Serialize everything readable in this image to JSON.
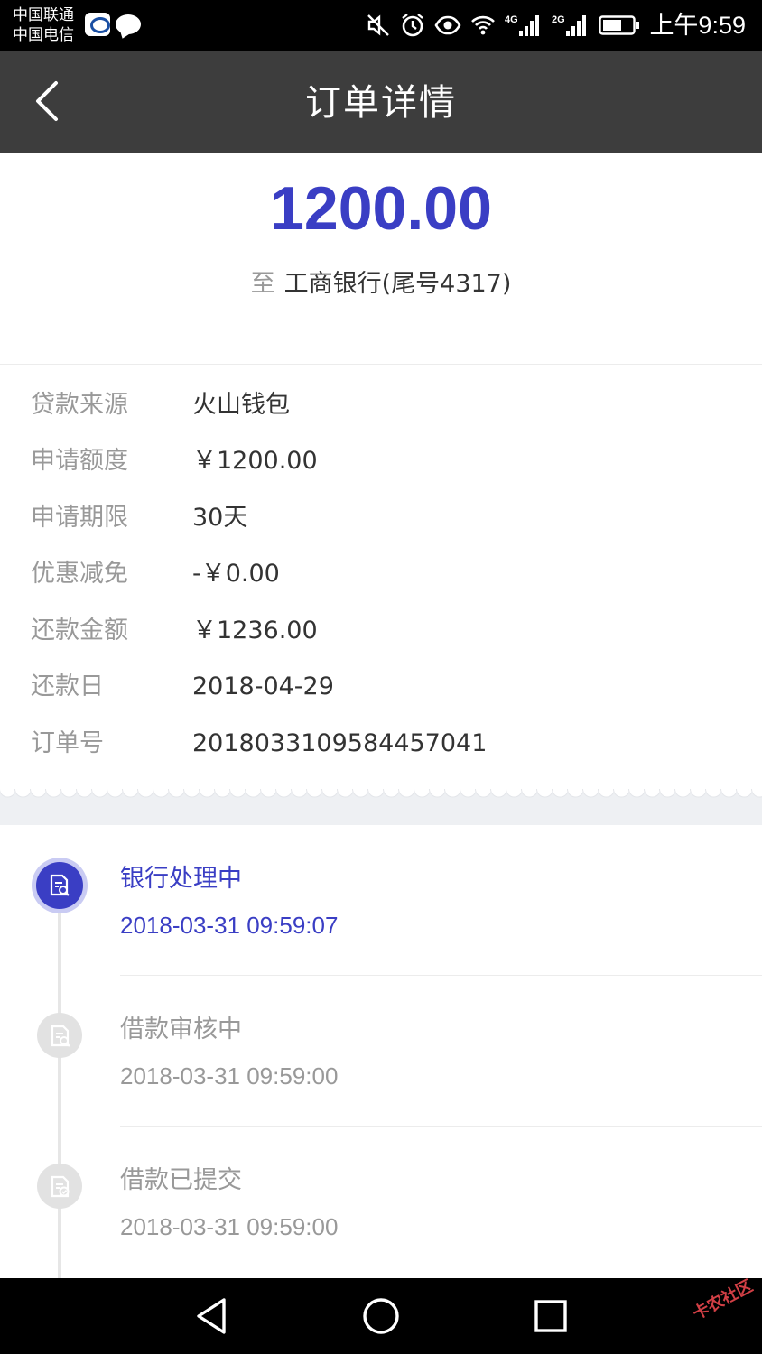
{
  "status_bar": {
    "carrier_1": "中国联通",
    "carrier_2": "中国电信",
    "network_1": "4G",
    "network_2": "2G",
    "time": "上午9:59"
  },
  "header": {
    "title": "订单详情",
    "back_icon": "chevron-left-icon"
  },
  "summary": {
    "amount": "1200.00",
    "dest_prefix": "至",
    "dest_account": "工商银行(尾号4317)",
    "accent_color": "#3a3ec4"
  },
  "details": [
    {
      "label": "贷款来源",
      "value": "火山钱包"
    },
    {
      "label": "申请额度",
      "value": "￥1200.00"
    },
    {
      "label": "申请期限",
      "value": "30天"
    },
    {
      "label": "优惠减免",
      "value": "-￥0.00"
    },
    {
      "label": "还款金额",
      "value": "￥1236.00"
    },
    {
      "label": "还款日",
      "value": "2018-04-29"
    },
    {
      "label": "订单号",
      "value": "2018033109584457041"
    }
  ],
  "timeline": [
    {
      "title": "银行处理中",
      "time": "2018-03-31 09:59:07",
      "active": true,
      "icon": "document-search-icon"
    },
    {
      "title": "借款审核中",
      "time": "2018-03-31 09:59:00",
      "active": false,
      "icon": "document-search-icon"
    },
    {
      "title": "借款已提交",
      "time": "2018-03-31 09:59:00",
      "active": false,
      "icon": "document-check-icon"
    }
  ],
  "nav": {
    "back_icon": "triangle-back-icon",
    "home_icon": "circle-home-icon",
    "recents_icon": "square-recents-icon",
    "watermark": "卡农社区"
  }
}
